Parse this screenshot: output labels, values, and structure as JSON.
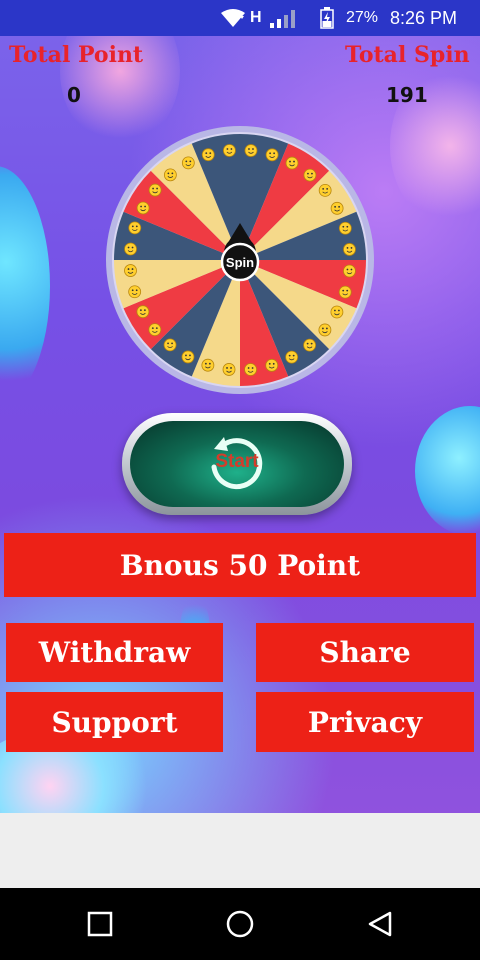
{
  "status_bar": {
    "network": "H",
    "battery": "27%",
    "time": "8:26 PM",
    "wifi_icon": "wifi-icon",
    "signal_icon": "signal-icon",
    "battery_icon": "battery-icon"
  },
  "header": {
    "total_point_label": "Total Point",
    "total_point_value": "0",
    "total_spin_label": "Total Spin",
    "total_spin_value": "191"
  },
  "wheel": {
    "center_label": "Spin",
    "segment_colors": [
      "#3c567a",
      "#ef3b43",
      "#f5d98a",
      "#3c567a",
      "#ef3b43",
      "#f5d98a",
      "#3c567a",
      "#ef3b43",
      "#f5d98a",
      "#3c567a",
      "#ef3b43",
      "#f5d98a",
      "#3c567a",
      "#ef3b43",
      "#f5d98a",
      "#3c567a"
    ],
    "emoji_icons": [
      "grin-emoji-icon",
      "wink-emoji-icon",
      "sunglasses-emoji-icon",
      "smile-emoji-icon",
      "kiss-emoji-icon",
      "laugh-emoji-icon"
    ]
  },
  "start_button": {
    "label": "Start"
  },
  "bonus_button": {
    "label": "Bnous 50 Point"
  },
  "buttons": {
    "withdraw": "Withdraw",
    "share": "Share",
    "support": "Support",
    "privacy": "Privacy"
  },
  "colors": {
    "status_bar": "#2b36c8",
    "red_button": "#ed2117",
    "header_label": "#e8232b"
  }
}
